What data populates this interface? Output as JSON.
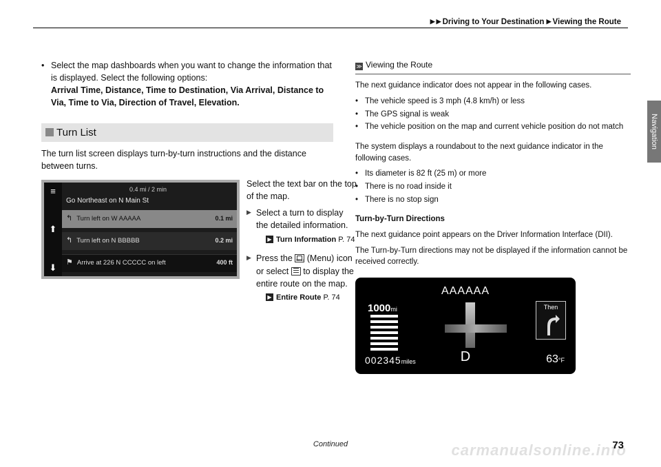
{
  "breadcrumb": {
    "a": "Driving to Your Destination",
    "b": "Viewing the Route"
  },
  "sidetab": "Navigation",
  "left": {
    "bullet1_a": "Select the map dashboards when you want to change the information that is displayed. Select the following options:",
    "bullet1_b": "Arrival Time, Distance, Time to Destination, Via Arrival, Distance to Via, Time to Via, Direction of Travel, Elevation.",
    "section_title": "Turn List",
    "turnlist_desc": "The turn list screen displays turn-by-turn instructions and the distance between turns."
  },
  "nav": {
    "top": "0.4 mi / 2 min",
    "sub": "Go Northeast on N Main St",
    "row1_text": "Turn left on W AAAAA",
    "row1_dist": "0.1 mi",
    "row2_text": "Turn left on N BBBBB",
    "row2_dist": "0.2 mi",
    "row3_text": "Arrive at 226 N CCCCC   on left",
    "row3_dist": "400 ft"
  },
  "mid": {
    "p1": "Select the text bar on the top of the map.",
    "sub1": "Select a turn to display the detailed information.",
    "ref1_label": "Turn Information",
    "ref1_page": "P. 74",
    "sub2a": "Press the ",
    "sub2b": " (Menu) icon or select ",
    "sub2c": " to display the entire route on the map.",
    "ref2_label": "Entire Route",
    "ref2_page": "P. 74"
  },
  "right": {
    "heading": "Viewing the Route",
    "p1": "The next guidance indicator does not appear in the following cases.",
    "b1": "The vehicle speed is 3 mph (4.8 km/h) or less",
    "b2": "The GPS signal is weak",
    "b3": "The vehicle position on the map and current vehicle position do not match",
    "p2": "The system displays a roundabout to the next guidance indicator in the following cases.",
    "b4": "Its diameter is 82 ft (25 m) or more",
    "b5": "There is no road inside it",
    "b6": "There is no stop sign",
    "h2": "Turn-by-Turn Directions",
    "p3": "The next guidance point appears on the Driver Information Interface (DII).",
    "p4": "The Turn-by-Turn directions may not be displayed if the information cannot be received correctly."
  },
  "dii": {
    "title": "AAAAAA",
    "dist": "1000",
    "dist_unit": "mi",
    "odo": "002345",
    "odo_unit": "miles",
    "gear": "D",
    "temp": "63",
    "temp_unit": "°F",
    "then": "Then"
  },
  "footer": {
    "continued": "Continued",
    "page": "73",
    "watermark": "carmanualsonline.info"
  }
}
